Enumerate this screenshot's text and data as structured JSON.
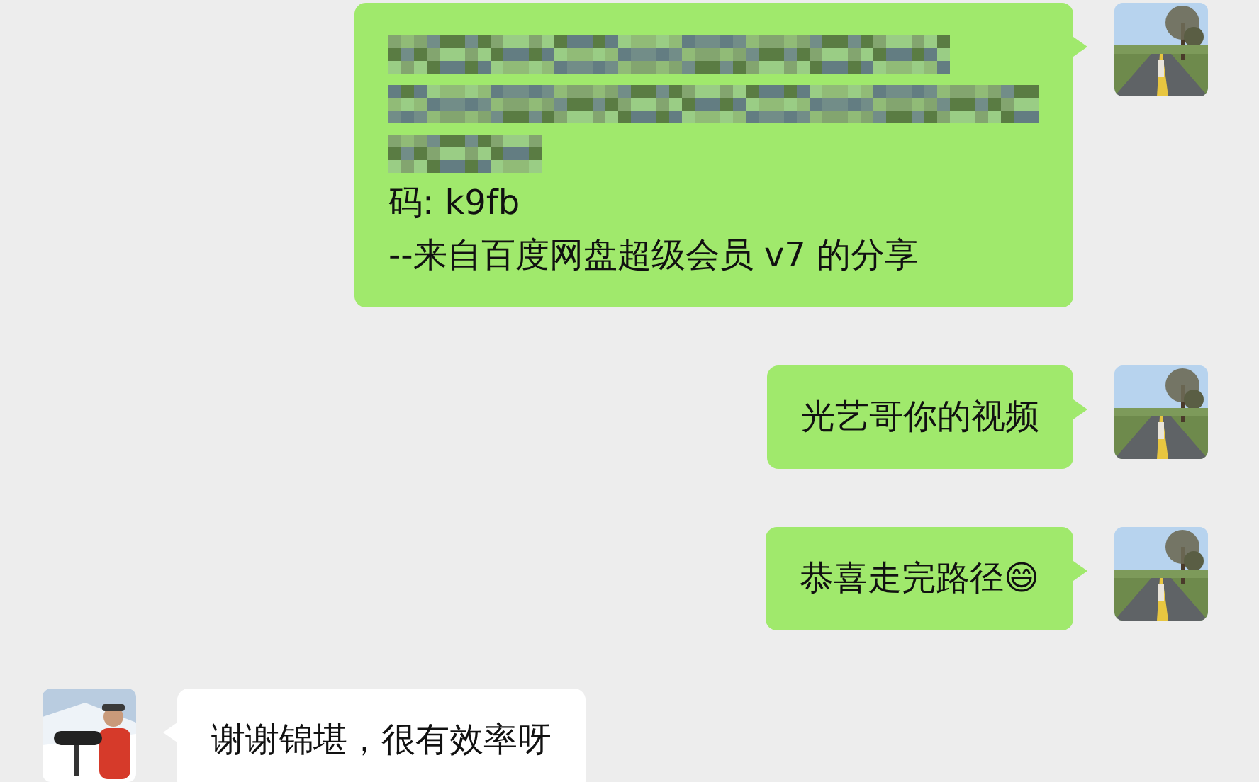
{
  "messages": [
    {
      "kind": "sent",
      "lines": [
        {
          "kind": "redacted"
        },
        {
          "kind": "redacted"
        },
        {
          "kind": "redacted"
        },
        {
          "kind": "text",
          "text": "码: k9fb"
        },
        {
          "kind": "text",
          "text": "--来自百度网盘超级会员 v7 的分享"
        }
      ]
    },
    {
      "kind": "sent",
      "lines": [
        {
          "kind": "text",
          "text": "光艺哥你的视频"
        }
      ]
    },
    {
      "kind": "sent",
      "lines": [
        {
          "kind": "text",
          "text": "恭喜走完路径😄"
        }
      ]
    },
    {
      "kind": "received",
      "lines": [
        {
          "kind": "text",
          "text": "谢谢锦堪，很有效率呀"
        }
      ]
    }
  ]
}
